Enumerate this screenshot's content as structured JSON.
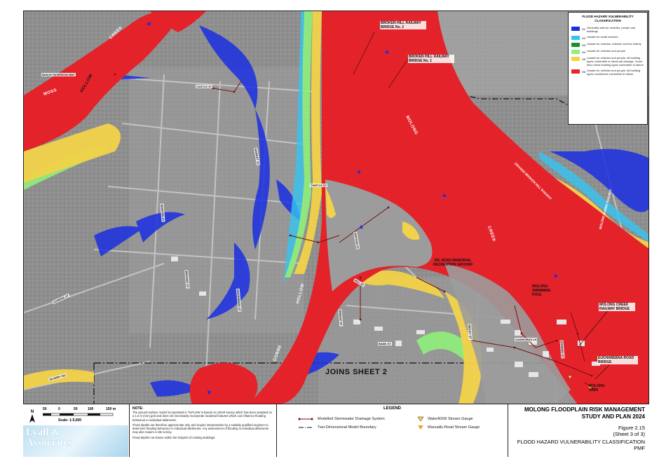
{
  "map": {
    "joins_label": "JOINS SHEET 2",
    "creek_labels": [
      "MOSS",
      "CREEK",
      "HOLLOW",
      "MOLONG",
      "CREEK",
      "HOLLOW",
      "GOBBE"
    ],
    "place_labels": [
      "BROKEN HILL RAILWAY BRIDGE No. 2",
      "BROKEN HILL RAILWAY BRIDGE No. 1",
      "DR. ROSS MEMORIAL RECREATION GROUND",
      "MOLONG SWIMMING POOL",
      "MOLONG CREEK RAILWAY BRIDGE",
      "EUCHAREENA ROAD BRIDGE",
      "MOLONG WEIR"
    ],
    "road_labels": [
      "BANJO PATERSON WAY",
      "CASTLE ST",
      "MARKET ST",
      "THIRTLE ST",
      "ORANGE BROKEN HILL RAILWAY",
      "MOLONG DUBBO RAILWAY",
      "WATSON ST",
      "HILL ST",
      "BANK ST",
      "GASWORKS LN",
      "RIDLEY ST",
      "EDWARD ST",
      "QUARRY RD",
      "GAREMA ST",
      "MORTON ST",
      "BROOKE ST",
      "WOODWARD ST",
      "BRIDGE ST"
    ]
  },
  "hazard_legend": {
    "title": "FLOOD HAZARD VULNERABILITY CLASSIFICATION",
    "items": [
      {
        "code": "H1",
        "color": "#1a2fe0",
        "desc": "Generally safe for vehicles, people and buildings"
      },
      {
        "code": "H2",
        "color": "#35c4f0",
        "desc": "Unsafe for small vehicles"
      },
      {
        "code": "H3",
        "color": "#1e8f2e",
        "desc": "Unsafe for vehicles, children and the elderly"
      },
      {
        "code": "H4",
        "color": "#8ff07a",
        "desc": "Unsafe for vehicles and people"
      },
      {
        "code": "H5",
        "color": "#f2d24a",
        "desc": "Unsafe for vehicles and people. All building types vulnerable to structural damage. Some less robust building types vulnerable to failure"
      },
      {
        "code": "H6",
        "color": "#e8242b",
        "desc": "Unsafe for vehicles and people. All building types considered vulnerable to failure"
      }
    ]
  },
  "scale": {
    "ticks": [
      "50",
      "0",
      "50",
      "100",
      "150 m"
    ],
    "text": "Scale: 1:5,000",
    "north": "N"
  },
  "notes": {
    "heading": "NOTE:",
    "paragraphs": [
      "The ground surface model incorporated in TUFLOW is based on LiDAR survey which has been sampled on a 1.5 m (mm) grid and does not necessarily incorporate localised features which can influence flooding behaviour in individual allotments.",
      "Flood depths are therefore approximate only and require interpretation by a suitably qualified engineer to determine flooding behaviour in individual allotments. Any assessment of flooding in individual allotments may also require a site survey.",
      "Flood depths not shown within the footprint of existing buildings."
    ]
  },
  "legend": {
    "heading": "LEGEND",
    "items": [
      "Modelled Stormwater Drainage System",
      "Two-Dimensional Model Boundary",
      "WaterNSW Stream Gauge",
      "Manually-Read Stream Gauge"
    ]
  },
  "logo": {
    "line1": "Lyall &",
    "line2": "Associates"
  },
  "title_block": {
    "project_line1": "MOLONG FLOODPLAIN RISK MANAGEMENT",
    "project_line2": "STUDY AND PLAN 2024",
    "figure": "Figure 2.15",
    "sheet": "(Sheet 3 of 3)",
    "classification": "FLOOD HAZARD VULNERABILITY CLASSIFICATION",
    "event": "PMF"
  }
}
